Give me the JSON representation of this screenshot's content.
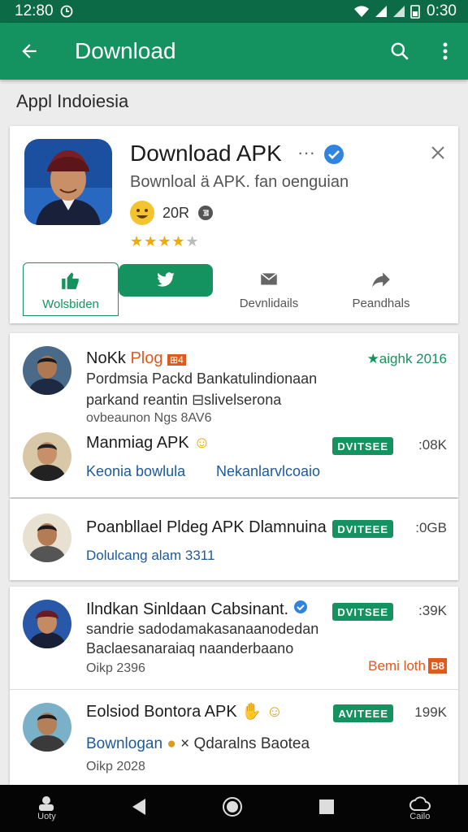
{
  "status_bar": {
    "time": "12:80",
    "right_time": "0:30"
  },
  "app_bar": {
    "title": "Download"
  },
  "section_label": "Appl Indoiesia",
  "featured": {
    "title": "Download APK",
    "more": "···",
    "subtitle": "Bownloal ä APK. fan oenguian",
    "count": "20R",
    "rating": 3.5,
    "actions": [
      {
        "label": "Wolsbiden",
        "icon": "thumbs-up-icon"
      },
      {
        "label": "",
        "icon": "bird-icon"
      },
      {
        "label": "Devnlidails",
        "icon": "mail-icon"
      },
      {
        "label": "Peandhals",
        "icon": "share-icon"
      }
    ]
  },
  "list": [
    {
      "title": "NoKk",
      "title_tag": "Plog",
      "badge": "⊞4",
      "right_label": "★aighk 2016",
      "line1": "Pordmsia Packd Bankatulindionaan",
      "line2": "parkand reantin ⊟slivelserona",
      "small": "ovbeaunon Ngs 8AV6"
    },
    {
      "title": "Manmiag APK",
      "badge": "DVITSEE",
      "right_num": ":08K",
      "link1": "Keonia bowlula",
      "link2": "Nekanlarvlcoaio"
    },
    {
      "title": "Poanbllael Pldeg APK Dlamnuina",
      "badge": "DVITEEE",
      "right_num": ":0GB",
      "small": "Dolulcang alam 3311"
    },
    {
      "title": "Ilndkan Sinldaan Cabsinant.",
      "badge": "DVITSEE",
      "right_num": ":39K",
      "line1": "sandrie sadodamakasanaanodedan",
      "line2": "Baclaesanaraiaq naanderbaano",
      "small": "Oikp 2396",
      "promo": "Bemi loth",
      "promo_badge": "B8"
    },
    {
      "title": "Eolsiod Bontora APK",
      "badge": "AVITEEE",
      "right_num": "199K",
      "link1": "Bownlogan",
      "link2": "× Qdaralns Baotea",
      "small": "Oikp 2028"
    }
  ],
  "nav": {
    "left_label": "Uoty",
    "right_label": "Cailo"
  },
  "colors": {
    "primary": "#14925f",
    "dark": "#0c6a46",
    "accent": "#e05a1e"
  }
}
